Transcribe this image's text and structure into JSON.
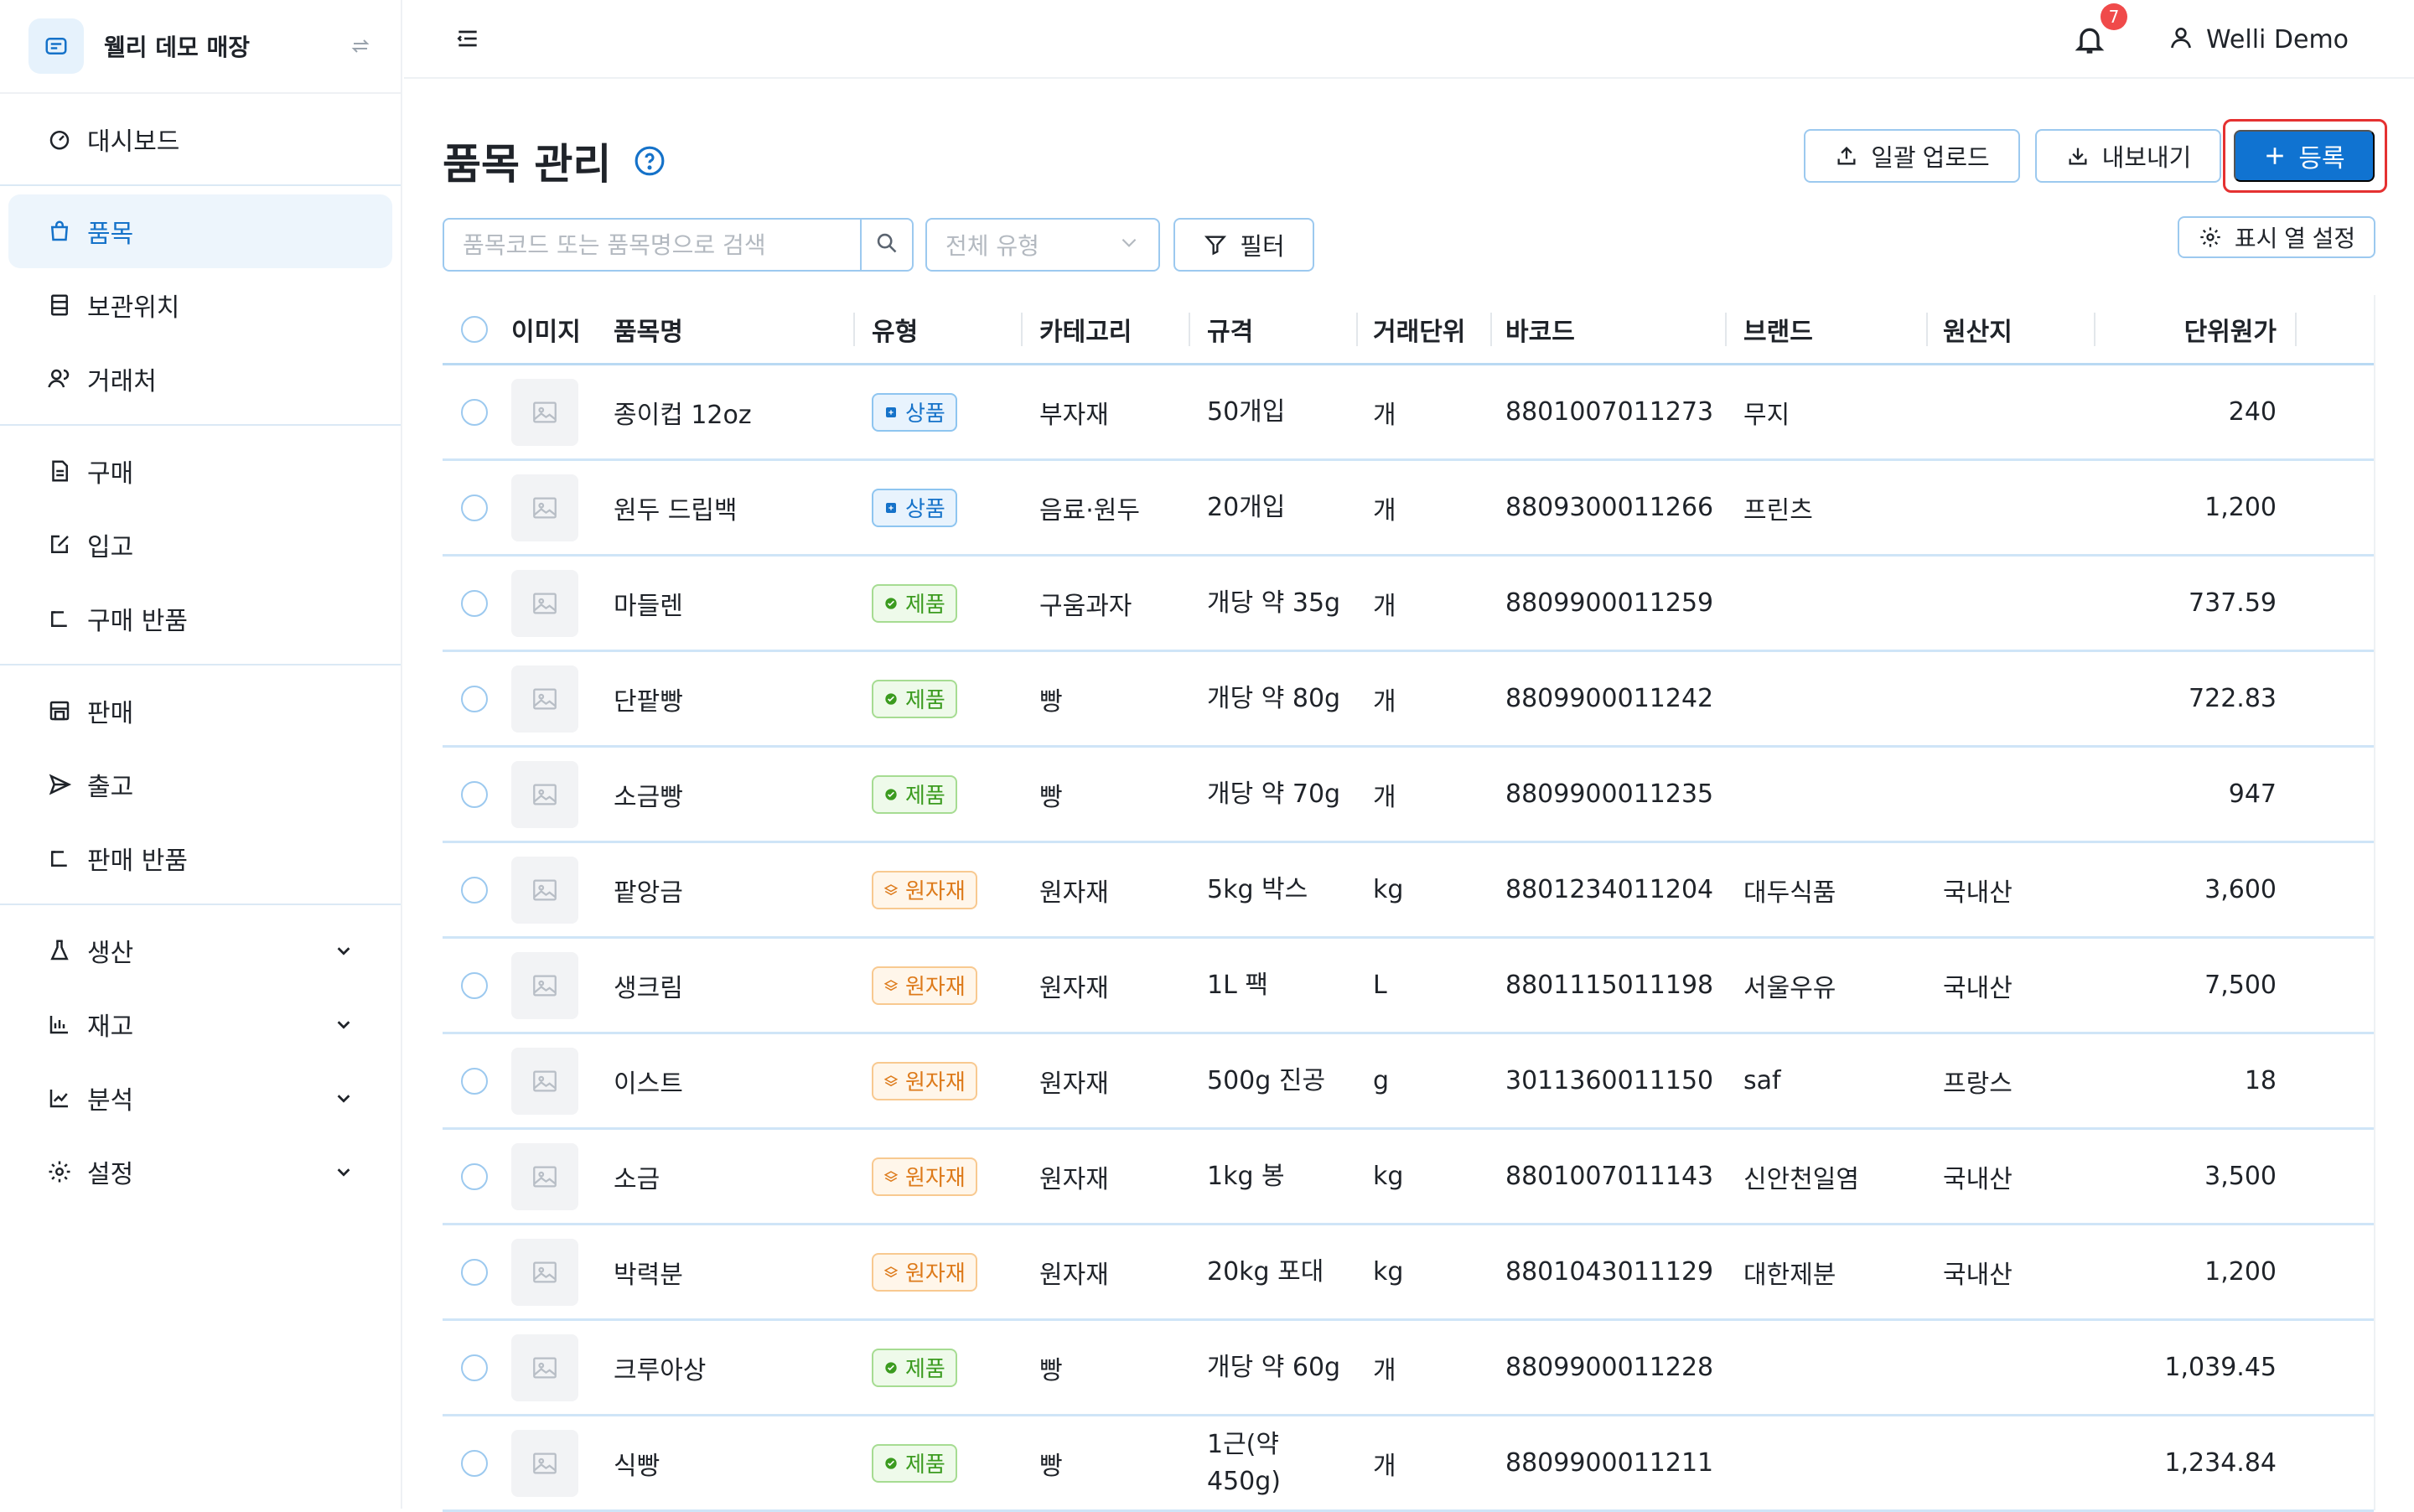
{
  "store": {
    "name": "웰리 데모 매장"
  },
  "sidebar": {
    "groups": [
      [
        {
          "label": "대시보드",
          "icon": "dashboard-icon"
        }
      ],
      [
        {
          "label": "품목",
          "icon": "bag-icon"
        },
        {
          "label": "보관위치",
          "icon": "storage-icon"
        },
        {
          "label": "거래처",
          "icon": "partners-icon"
        }
      ],
      [
        {
          "label": "구매",
          "icon": "document-icon"
        },
        {
          "label": "입고",
          "icon": "inbound-icon"
        },
        {
          "label": "구매 반품",
          "icon": "return-icon"
        }
      ],
      [
        {
          "label": "판매",
          "icon": "store-icon"
        },
        {
          "label": "출고",
          "icon": "send-icon"
        },
        {
          "label": "판매 반품",
          "icon": "return-icon"
        }
      ],
      [
        {
          "label": "생산",
          "icon": "flask-icon"
        },
        {
          "label": "재고",
          "icon": "bar-chart-icon"
        },
        {
          "label": "분석",
          "icon": "line-chart-icon"
        },
        {
          "label": "설정",
          "icon": "gear-icon"
        }
      ]
    ]
  },
  "topbar": {
    "notification_count": "7",
    "user_name": "Welli Demo"
  },
  "page": {
    "title": "품목 관리",
    "buttons": {
      "upload": "일괄 업로드",
      "export": "내보내기",
      "register": "등록",
      "filter": "필터",
      "columns": "표시 열 설정"
    },
    "search": {
      "placeholder": "품목코드 또는 품목명으로 검색",
      "value": ""
    },
    "type_select": "전체 유형"
  },
  "table": {
    "headers": {
      "image": "이미지",
      "name": "품목명",
      "type": "유형",
      "category": "카테고리",
      "spec": "규격",
      "unit": "거래단위",
      "barcode": "바코드",
      "brand": "브랜드",
      "origin": "원산지",
      "price": "단위원가"
    },
    "rows": [
      {
        "name": "종이컵 12oz",
        "type": "상품",
        "type_kind": "goods",
        "category": "부자재",
        "spec": "50개입",
        "unit": "개",
        "barcode": "8801007011273",
        "brand": "무지",
        "origin": "",
        "price": "240"
      },
      {
        "name": "원두 드립백",
        "type": "상품",
        "type_kind": "goods",
        "category": "음료·원두",
        "spec": "20개입",
        "unit": "개",
        "barcode": "8809300011266",
        "brand": "프린츠",
        "origin": "",
        "price": "1,200"
      },
      {
        "name": "마들렌",
        "type": "제품",
        "type_kind": "product",
        "category": "구움과자",
        "spec": "개당 약 35g",
        "unit": "개",
        "barcode": "8809900011259",
        "brand": "",
        "origin": "",
        "price": "737.59"
      },
      {
        "name": "단팥빵",
        "type": "제품",
        "type_kind": "product",
        "category": "빵",
        "spec": "개당 약 80g",
        "unit": "개",
        "barcode": "8809900011242",
        "brand": "",
        "origin": "",
        "price": "722.83"
      },
      {
        "name": "소금빵",
        "type": "제품",
        "type_kind": "product",
        "category": "빵",
        "spec": "개당 약 70g",
        "unit": "개",
        "barcode": "8809900011235",
        "brand": "",
        "origin": "",
        "price": "947"
      },
      {
        "name": "팥앙금",
        "type": "원자재",
        "type_kind": "raw",
        "category": "원자재",
        "spec": "5kg 박스",
        "unit": "kg",
        "barcode": "8801234011204",
        "brand": "대두식품",
        "origin": "국내산",
        "price": "3,600"
      },
      {
        "name": "생크림",
        "type": "원자재",
        "type_kind": "raw",
        "category": "원자재",
        "spec": "1L 팩",
        "unit": "L",
        "barcode": "8801115011198",
        "brand": "서울우유",
        "origin": "국내산",
        "price": "7,500"
      },
      {
        "name": "이스트",
        "type": "원자재",
        "type_kind": "raw",
        "category": "원자재",
        "spec": "500g 진공",
        "unit": "g",
        "barcode": "3011360011150",
        "brand": "saf",
        "origin": "프랑스",
        "price": "18"
      },
      {
        "name": "소금",
        "type": "원자재",
        "type_kind": "raw",
        "category": "원자재",
        "spec": "1kg 봉",
        "unit": "kg",
        "barcode": "8801007011143",
        "brand": "신안천일염",
        "origin": "국내산",
        "price": "3,500"
      },
      {
        "name": "박력분",
        "type": "원자재",
        "type_kind": "raw",
        "category": "원자재",
        "spec": "20kg 포대",
        "unit": "kg",
        "barcode": "8801043011129",
        "brand": "대한제분",
        "origin": "국내산",
        "price": "1,200"
      },
      {
        "name": "크루아상",
        "type": "제품",
        "type_kind": "product",
        "category": "빵",
        "spec": "개당 약 60g",
        "unit": "개",
        "barcode": "8809900011228",
        "brand": "",
        "origin": "",
        "price": "1,039.45"
      },
      {
        "name": "식빵",
        "type": "제품",
        "type_kind": "product",
        "category": "빵",
        "spec": "1근(약 450g)",
        "unit": "개",
        "barcode": "8809900011211",
        "brand": "",
        "origin": "",
        "price": "1,234.84"
      }
    ]
  },
  "colors": {
    "accent": "#1073d1",
    "highlight_border": "#e53131",
    "badge_goods": "#1572c9",
    "badge_product": "#3b9b1f",
    "badge_raw": "#dd7a1a"
  }
}
